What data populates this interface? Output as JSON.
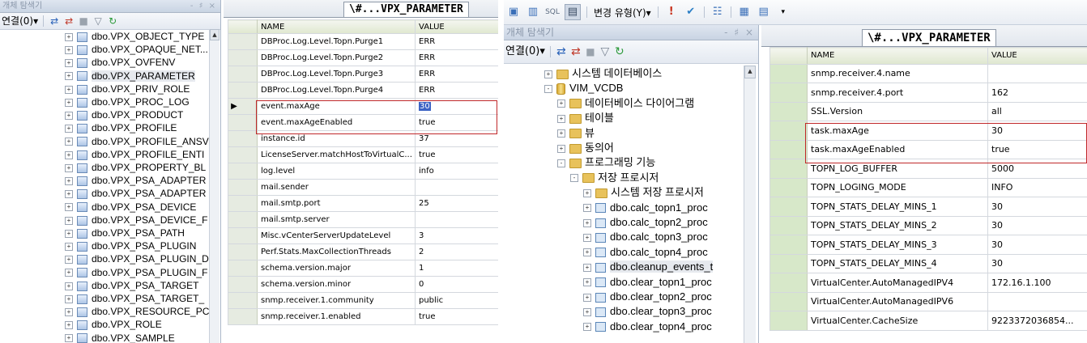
{
  "left": {
    "explorer_title": "개체 탐색기",
    "explorer_pins": "- ♯ ×",
    "connect_label": "연결(0)▾",
    "tree_items": [
      "dbo.VPX_OBJECT_TYPE",
      "dbo.VPX_OPAQUE_NET...",
      "dbo.VPX_OVFENV",
      "dbo.VPX_PARAMETER",
      "dbo.VPX_PRIV_ROLE",
      "dbo.VPX_PROC_LOG",
      "dbo.VPX_PRODUCT",
      "dbo.VPX_PROFILE",
      "dbo.VPX_PROFILE_ANSV",
      "dbo.VPX_PROFILE_ENTI",
      "dbo.VPX_PROPERTY_BL",
      "dbo.VPX_PSA_ADAPTER",
      "dbo.VPX_PSA_ADAPTER",
      "dbo.VPX_PSA_DEVICE",
      "dbo.VPX_PSA_DEVICE_F",
      "dbo.VPX_PSA_PATH",
      "dbo.VPX_PSA_PLUGIN",
      "dbo.VPX_PSA_PLUGIN_D",
      "dbo.VPX_PSA_PLUGIN_F",
      "dbo.VPX_PSA_TARGET",
      "dbo.VPX_PSA_TARGET_",
      "dbo.VPX_RESOURCE_PC",
      "dbo.VPX_ROLE",
      "dbo.VPX_SAMPLE"
    ],
    "tab_title": "\\#...VPX_PARAMETER",
    "columns": [
      "NAME",
      "VALUE"
    ],
    "rows": [
      {
        "name": "DBProc.Log.Level.Topn.Purge1",
        "value": "ERR"
      },
      {
        "name": "DBProc.Log.Level.Topn.Purge2",
        "value": "ERR"
      },
      {
        "name": "DBProc.Log.Level.Topn.Purge3",
        "value": "ERR"
      },
      {
        "name": "DBProc.Log.Level.Topn.Purge4",
        "value": "ERR"
      },
      {
        "name": "event.maxAge",
        "value": "30"
      },
      {
        "name": "event.maxAgeEnabled",
        "value": "true"
      },
      {
        "name": "instance.id",
        "value": "37"
      },
      {
        "name": "LicenseServer.matchHostToVirtualC...",
        "value": "true"
      },
      {
        "name": "log.level",
        "value": "info"
      },
      {
        "name": "mail.sender",
        "value": ""
      },
      {
        "name": "mail.smtp.port",
        "value": "25"
      },
      {
        "name": "mail.smtp.server",
        "value": ""
      },
      {
        "name": "Misc.vCenterServerUpdateLevel",
        "value": "3"
      },
      {
        "name": "Perf.Stats.MaxCollectionThreads",
        "value": "2"
      },
      {
        "name": "schema.version.major",
        "value": "1"
      },
      {
        "name": "schema.version.minor",
        "value": "0"
      },
      {
        "name": "snmp.receiver.1.community",
        "value": "public"
      },
      {
        "name": "snmp.receiver.1.enabled",
        "value": "true"
      }
    ]
  },
  "right": {
    "toolbar_change_type": "변경 유형(Y)▾",
    "explorer_title": "개체 탐색기",
    "explorer_pins": "- ♯ ×",
    "connect_label": "연결(0)▾",
    "tree_items": [
      {
        "label": "시스템 데이터베이스",
        "kind": "folder",
        "indent": 0,
        "expander": "+"
      },
      {
        "label": "VIM_VCDB",
        "kind": "db",
        "indent": 0,
        "expander": "-"
      },
      {
        "label": "데이터베이스 다이어그램",
        "kind": "folder",
        "indent": 1,
        "expander": "+"
      },
      {
        "label": "테이블",
        "kind": "folder",
        "indent": 1,
        "expander": "+"
      },
      {
        "label": "뷰",
        "kind": "folder",
        "indent": 1,
        "expander": "+"
      },
      {
        "label": "동의어",
        "kind": "folder",
        "indent": 1,
        "expander": "+"
      },
      {
        "label": "프로그래밍 기능",
        "kind": "folder",
        "indent": 1,
        "expander": "-"
      },
      {
        "label": "저장 프로시저",
        "kind": "folder",
        "indent": 2,
        "expander": "-"
      },
      {
        "label": "시스템 저장 프로시저",
        "kind": "folder",
        "indent": 3,
        "expander": "+"
      },
      {
        "label": "dbo.calc_topn1_proc",
        "kind": "proc",
        "indent": 3,
        "expander": "+"
      },
      {
        "label": "dbo.calc_topn2_proc",
        "kind": "proc",
        "indent": 3,
        "expander": "+"
      },
      {
        "label": "dbo.calc_topn3_proc",
        "kind": "proc",
        "indent": 3,
        "expander": "+"
      },
      {
        "label": "dbo.calc_topn4_proc",
        "kind": "proc",
        "indent": 3,
        "expander": "+"
      },
      {
        "label": "dbo.cleanup_events_t",
        "kind": "proc",
        "indent": 3,
        "expander": "+"
      },
      {
        "label": "dbo.clear_topn1_proc",
        "kind": "proc",
        "indent": 3,
        "expander": "+"
      },
      {
        "label": "dbo.clear_topn2_proc",
        "kind": "proc",
        "indent": 3,
        "expander": "+"
      },
      {
        "label": "dbo.clear_topn3_proc",
        "kind": "proc",
        "indent": 3,
        "expander": "+"
      },
      {
        "label": "dbo.clear_topn4_proc",
        "kind": "proc",
        "indent": 3,
        "expander": "+"
      }
    ],
    "tab_title": "\\#...VPX_PARAMETER",
    "columns": [
      "NAME",
      "VALUE"
    ],
    "rows": [
      {
        "name": "snmp.receiver.4.name",
        "value": ""
      },
      {
        "name": "snmp.receiver.4.port",
        "value": "162"
      },
      {
        "name": "SSL.Version",
        "value": "all"
      },
      {
        "name": "task.maxAge",
        "value": "30"
      },
      {
        "name": "task.maxAgeEnabled",
        "value": "true"
      },
      {
        "name": "TOPN_LOG_BUFFER",
        "value": "5000"
      },
      {
        "name": "TOPN_LOGING_MODE",
        "value": "INFO"
      },
      {
        "name": "TOPN_STATS_DELAY_MINS_1",
        "value": "30"
      },
      {
        "name": "TOPN_STATS_DELAY_MINS_2",
        "value": "30"
      },
      {
        "name": "TOPN_STATS_DELAY_MINS_3",
        "value": "30"
      },
      {
        "name": "TOPN_STATS_DELAY_MINS_4",
        "value": "30"
      },
      {
        "name": "VirtualCenter.AutoManagedIPV4",
        "value": "172.16.1.100"
      },
      {
        "name": "VirtualCenter.AutoManagedIPV6",
        "value": ""
      },
      {
        "name": "VirtualCenter.CacheSize",
        "value": "9223372036854..."
      }
    ]
  },
  "colors": {
    "highlight_border": "#c0282a",
    "selected_cell": "#3c63c4"
  }
}
